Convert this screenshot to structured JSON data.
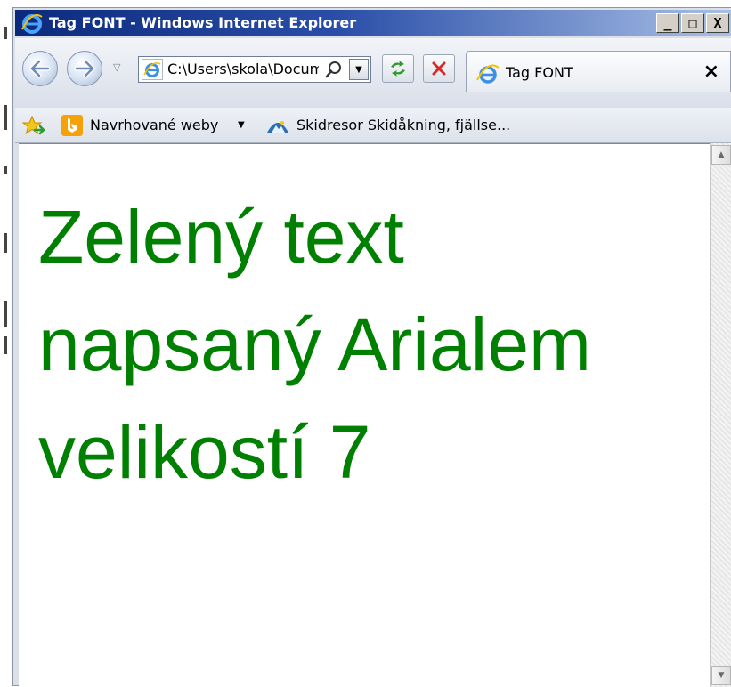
{
  "window": {
    "title": "Tag FONT - Windows Internet Explorer",
    "minimize_label": "_",
    "maximize_label": "□",
    "close_label": "X"
  },
  "navigation": {
    "address": "C:\\Users\\skola\\Documents\\font.html",
    "tab_title": "Tag FONT",
    "tab_close_label": "×"
  },
  "favorites": {
    "items": [
      {
        "label": "Navrhované weby"
      },
      {
        "label": "Skidresor Skidåkning, fjällse..."
      }
    ]
  },
  "page": {
    "text": "Zelený text napsaný Arialem velikostí 7",
    "text_color": "#008000",
    "font_size_attribute": "7"
  },
  "colors": {
    "titlebar_start": "#0c2a7c",
    "titlebar_end": "#a8c0e6",
    "content_background": "#ffffff"
  },
  "icons": {
    "back": "back-arrow-icon",
    "forward": "forward-arrow-icon",
    "refresh": "refresh-icon",
    "stop": "stop-icon",
    "search": "search-icon",
    "favorites": "favorites-star-icon"
  }
}
